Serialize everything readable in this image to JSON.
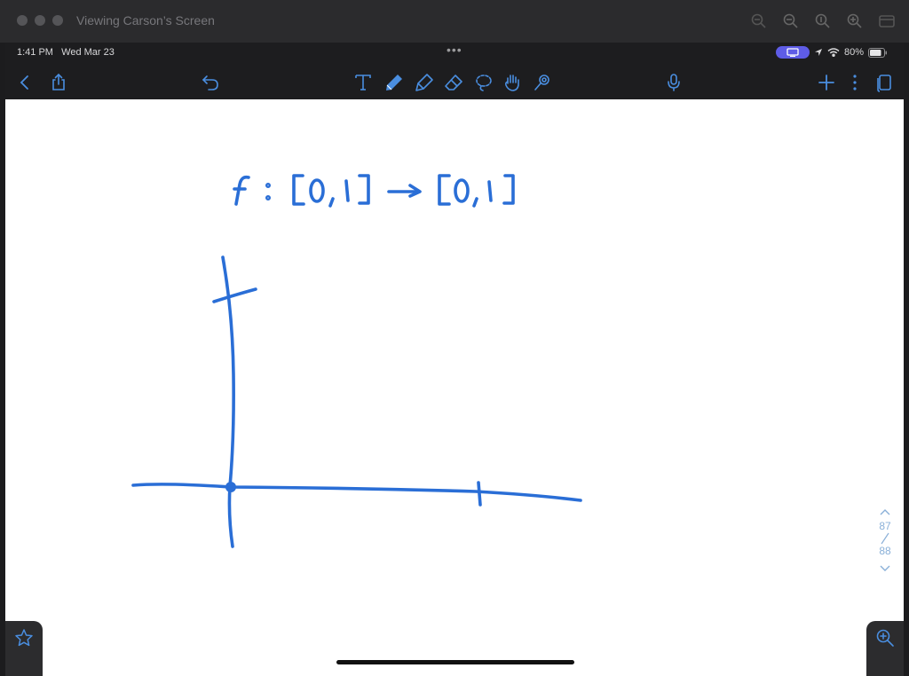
{
  "window": {
    "title": "Viewing Carson’s Screen",
    "tools": [
      "zoom-out-dim-icon",
      "zoom-out-icon",
      "zoom-fit-icon",
      "zoom-in-icon",
      "window-icon"
    ]
  },
  "status_bar": {
    "time": "1:41 PM",
    "date": "Wed Mar 23",
    "battery": "80%"
  },
  "toolbar": {
    "left": [
      "back-icon",
      "share-icon",
      "undo-icon"
    ],
    "center": [
      "text-tool-icon",
      "pen-tool-icon",
      "highlighter-tool-icon",
      "eraser-tool-icon",
      "lasso-tool-icon",
      "hand-tool-icon",
      "laser-pointer-icon"
    ],
    "right": [
      "microphone-icon",
      "add-page-icon",
      "more-icon",
      "pages-icon"
    ],
    "ink_color": "#2f6fd6",
    "active_tool": "pen-tool-icon"
  },
  "pager": {
    "current": "87",
    "total": "88"
  },
  "colors": {
    "ink": "#2a6ed6",
    "accent": "#4a8ee0",
    "screen_share": "#5e5ce6"
  }
}
